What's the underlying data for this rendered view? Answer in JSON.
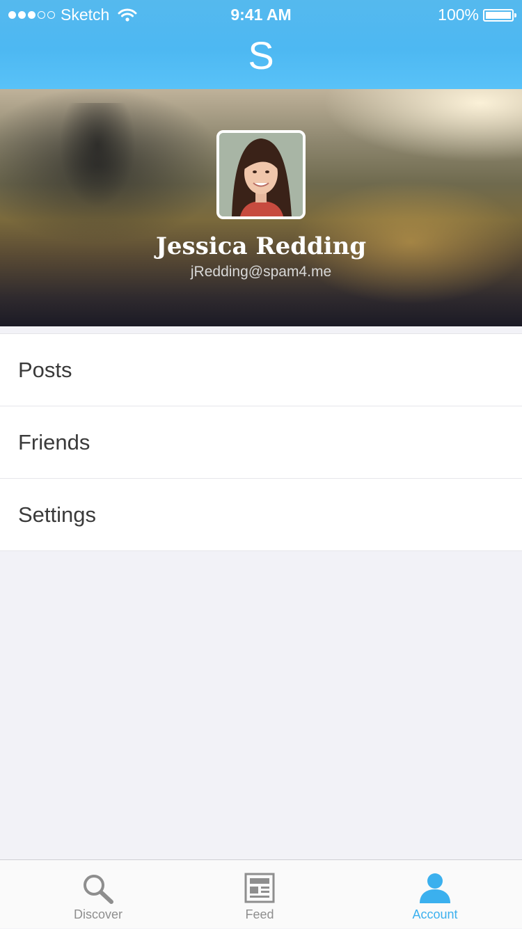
{
  "status_bar": {
    "carrier": "Sketch",
    "time": "9:41 AM",
    "battery": "100%"
  },
  "nav": {
    "title": "S"
  },
  "profile": {
    "name": "Jessica Redding",
    "email": "jRedding@spam4.me"
  },
  "menu": {
    "items": [
      {
        "label": "Posts"
      },
      {
        "label": "Friends"
      },
      {
        "label": "Settings"
      }
    ]
  },
  "tab_bar": {
    "items": [
      {
        "label": "Discover",
        "icon": "search-icon",
        "active": false
      },
      {
        "label": "Feed",
        "icon": "newspaper-icon",
        "active": false
      },
      {
        "label": "Account",
        "icon": "person-icon",
        "active": true
      }
    ],
    "active_color": "#3bb0ee",
    "inactive_color": "#8e8e8e"
  },
  "colors": {
    "nav_blue": "#4db8f2",
    "background": "#f2f2f7"
  }
}
